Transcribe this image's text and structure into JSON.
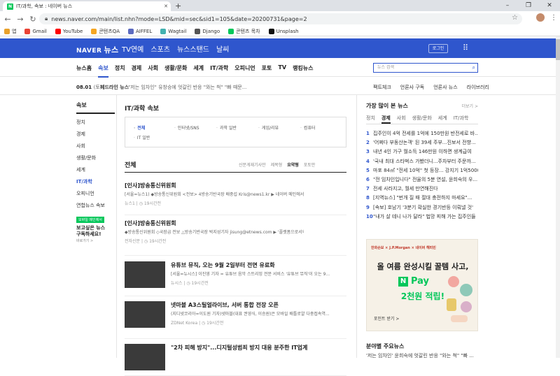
{
  "browser": {
    "tab_title": "IT/과학, 속보 : 네이버 뉴스",
    "favicon_letter": "N",
    "new_tab": "+",
    "url": "news.naver.com/main/list.nhn?mode=LSD&mid=sec&sid1=105&date=20200731&page=2",
    "window_controls": [
      "–",
      "❐",
      "✕"
    ],
    "bookmarks": [
      {
        "label": "앱",
        "color": "#e9a12b"
      },
      {
        "label": "Gmail",
        "color": "#ea4335"
      },
      {
        "label": "YouTube",
        "color": "#ff0000"
      },
      {
        "label": "콘텐츠QA",
        "color": "#f5a623"
      },
      {
        "label": "AIFFEL",
        "color": "#5c6bc0"
      },
      {
        "label": "Wagtail",
        "color": "#43b1b0"
      },
      {
        "label": "Django",
        "color": "#555555"
      },
      {
        "label": "콘텐츠 목차",
        "color": "#03c75a"
      },
      {
        "label": "Unsplash",
        "color": "#111111"
      }
    ]
  },
  "header": {
    "logo": "NAVER",
    "logo_section": "뉴스",
    "nav": [
      "TV연예",
      "스포츠",
      "뉴스스탠드",
      "날씨"
    ],
    "login": "로그인"
  },
  "subnav": {
    "items": [
      "뉴스홈",
      "속보",
      "정치",
      "경제",
      "사회",
      "생활/문화",
      "세계",
      "IT/과학",
      "오피니언",
      "포토",
      "TV",
      "랭킹뉴스"
    ],
    "active_index": 1,
    "search_placeholder": "뉴스 검색"
  },
  "headline_bar": {
    "date": "08.01",
    "dow": "(토)",
    "label": "헤드라인 뉴스",
    "text": "\"저는 임차인\" 유창승에 엇갈린 반응 \"와는 척\" \"빠 때문...",
    "links": [
      "팩트체크",
      "언론사 구독",
      "언론사 뉴스",
      "라이브러리"
    ]
  },
  "left_menu": {
    "title": "속보",
    "items": [
      "정치",
      "경제",
      "사회",
      "생활/문화",
      "세계",
      "IT/과학",
      "오피니언",
      "연합뉴스 속보"
    ],
    "active": "IT/과학",
    "mobile_tag": "모바일 메인에서",
    "mobile_text1": "보고싶은 뉴스",
    "mobile_text2": "구독하세요!",
    "mobile_sub": "바로가기 >"
  },
  "main": {
    "title": "IT/과학 속보",
    "categories": [
      "전체",
      "인터넷/SNS",
      "과학 일반",
      "게임/리뷰",
      "컴퓨터",
      "IT 일반"
    ],
    "active_category": "전체",
    "section_title": "전체",
    "sort_options": [
      "신문게재기사만",
      "제목형",
      "요약형",
      "포토만"
    ],
    "active_sort": "요약형",
    "articles": [
      {
        "title": "[인사]방송통신위원회",
        "desc": "[서울=뉴스1) ◆방송통신위원회 <전보> 4방송기반국장 배중섭 Kris@news1.kr ▶ 네이버 메인에서 [뉴스1] 구...",
        "source": "뉴스1",
        "time": "19시간전",
        "thumb": false
      },
      {
        "title": "[인사]방송통신위원회",
        "desc": "◆방송통신위원회 ◇국장급 전보 △방송기반국장 박지성기자 jisung@etnews.com ▶ '플랫폼으로서의 ...",
        "source": "전자신문",
        "time": "19시간전",
        "thumb": false
      },
      {
        "title": "유튜브 뮤직, 오는 9월 2일부터 전면 유료화",
        "desc": "[서울=뉴시스] 이진영 기자 = 유튜브 음악 스트리밍 전문 서비스 '유튜브 뮤직'이 오는 9...",
        "source": "뉴시스",
        "time": "19시간전",
        "thumb": true
      },
      {
        "title": "넷마블 A3스틸얼라이브, 서버 통합 전장 오픈",
        "desc": "(지디넷코리아=이도원 기자)넷마블(대표 권영식, 이승원)은 모바일 배틀로얄 다중접속역...",
        "source": "ZDNet Korea",
        "time": "19시간전",
        "thumb": true
      },
      {
        "title": "\"2차 피해 방지\"...디지털성범죄 방지 대응 분주한 IT업계",
        "desc": "",
        "source": "",
        "time": "",
        "thumb": true
      }
    ]
  },
  "right": {
    "title": "가장 많이 본 뉴스",
    "more": "더보기 >",
    "tabs": [
      "정치",
      "경제",
      "사회",
      "생활/문화",
      "세계",
      "IT/과학"
    ],
    "active_tab": "경제",
    "ranks": [
      "집주인이 4억 전세를 1억에 150만원 반전세로 바...",
      "'어쩌다 부동산논객' 된 39세 주부...진보서 전향...",
      "내년 4인 가구 월소득 146만원 이하면 생계급여",
      "'국내 최대 스타벅스 가봤더니...주차부터 주문까...",
      "마포 84㎡ \"전세 10억\" 첫 등장... 강지기 1억5000...",
      "\"전 임차인입니다\" 전율의 5분 연설, 윤희숙의 우...",
      "전세 사라지고, 월세 만연해진다",
      "[지역뉴스] \"번개 질 때 절대 충전하지 마세요\"...",
      "[속보] 호남기 '3분기 확실한 경기반등 이뤄낼 것'",
      "\"내가 살 테니 나가 달라\" 법망 피해 가는 집주인들"
    ],
    "ad": {
      "top": "한화손보 × J.P.Morgan × 네이버 해피빈",
      "headline": "올 여름 완성시킬 꿀템 사고,",
      "pay": "Pay",
      "green": "2천원 적립!",
      "button": "포인트 받기 >"
    },
    "sub_title": "분야별 주요뉴스",
    "sub_line": "'저는 임차인' 윤희숙에 엇갈린 반응 \"와는 척\" \"빠 ..."
  }
}
